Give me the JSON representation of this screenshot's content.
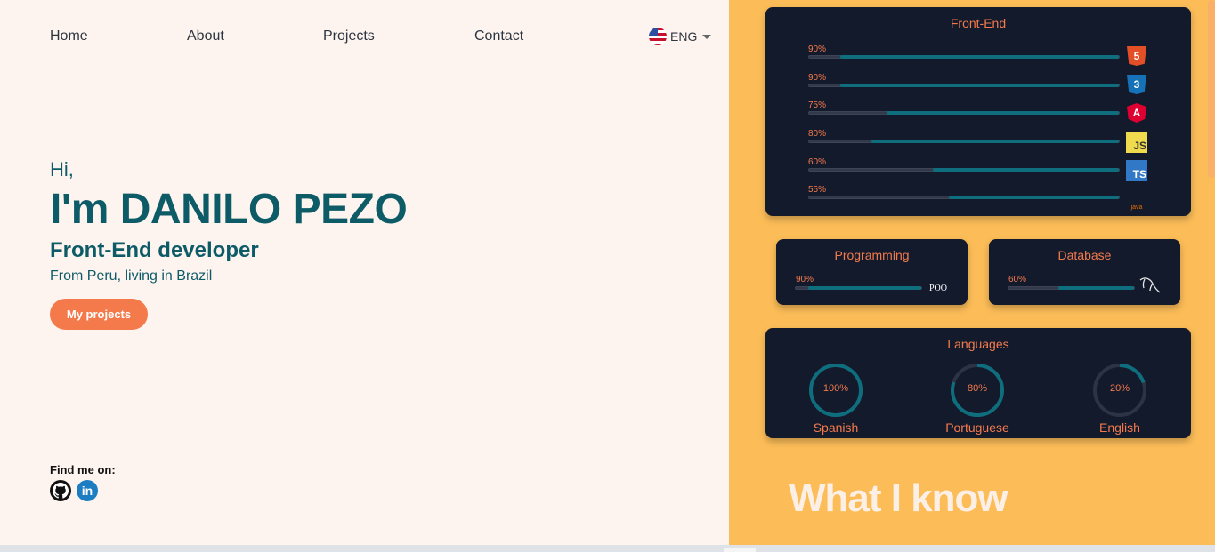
{
  "nav": {
    "items": [
      "Home",
      "About",
      "Projects",
      "Contact"
    ],
    "language": "ENG"
  },
  "hero": {
    "greeting": "Hi,",
    "name": "I'm DANILO PEZO",
    "role": "Front-End developer",
    "location": "From Peru, living in Brazil",
    "cta": "My projects",
    "find_me": "Find me on:",
    "socials": [
      "github-icon",
      "linkedin-icon"
    ]
  },
  "frontend": {
    "title": "Front-End",
    "skills": [
      {
        "pct": "90%",
        "value": 0.9,
        "icon": "html5-icon"
      },
      {
        "pct": "90%",
        "value": 0.9,
        "icon": "css3-icon"
      },
      {
        "pct": "75%",
        "value": 0.75,
        "icon": "angular-icon"
      },
      {
        "pct": "80%",
        "value": 0.8,
        "icon": "javascript-icon"
      },
      {
        "pct": "60%",
        "value": 0.6,
        "icon": "typescript-icon"
      },
      {
        "pct": "55%",
        "value": 0.55,
        "icon": "java-icon"
      }
    ]
  },
  "programming": {
    "title": "Programming",
    "pct": "90%",
    "value": 0.9,
    "icon_label": "POO"
  },
  "database": {
    "title": "Database",
    "pct": "60%",
    "value": 0.6,
    "icon": "mysql-dolphin-icon"
  },
  "languages": {
    "title": "Languages",
    "items": [
      {
        "name": "Spanish",
        "pct": "100%",
        "value": 1.0
      },
      {
        "name": "Portuguese",
        "pct": "80%",
        "value": 0.8
      },
      {
        "name": "English",
        "pct": "20%",
        "value": 0.2
      }
    ]
  },
  "section_title": "What I know",
  "colors": {
    "accent": "#f47a4c",
    "primary": "#0e5b68",
    "card": "#131a2c",
    "bar": "#0e6e7e",
    "panel": "#fcbd58"
  },
  "icon_text": {
    "html5": "5",
    "css3": "3",
    "angular": "A",
    "js": "JS",
    "ts": "TS",
    "java": "java",
    "linkedin": "in"
  }
}
